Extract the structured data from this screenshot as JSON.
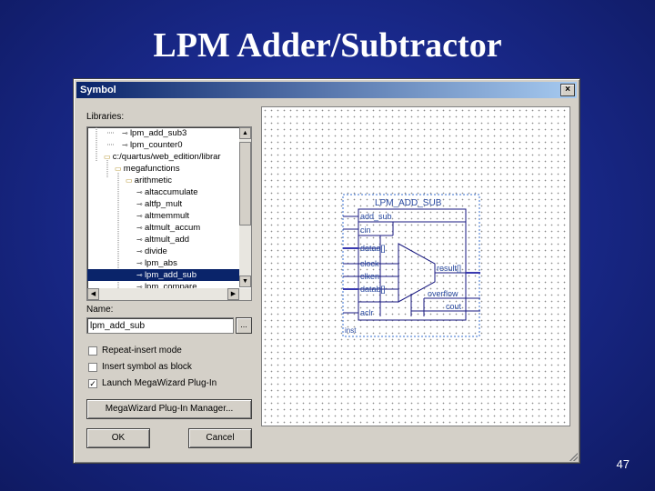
{
  "slide": {
    "title": "LPM Adder/Subtractor",
    "page_number": "47"
  },
  "dialog": {
    "title": "Symbol",
    "close_label": "×",
    "libraries_label": "Libraries:",
    "tree_items": [
      "lpm_add_sub3",
      "lpm_counter0",
      "c:/quartus/web_edition/librar",
      "megafunctions",
      "arithmetic",
      "altaccumulate",
      "altfp_mult",
      "altmemmult",
      "altmult_accum",
      "altmult_add",
      "divide",
      "lpm_abs",
      "lpm_add_sub",
      "lpm_compare"
    ],
    "selected_item": "lpm_add_sub",
    "name_label": "Name:",
    "name_value": "lpm_add_sub",
    "browse_label": "...",
    "checkboxes": [
      {
        "label": "Repeat-insert mode",
        "checked": false
      },
      {
        "label": "Insert symbol as block",
        "checked": false
      },
      {
        "label": "Launch MegaWizard Plug-In",
        "checked": true
      }
    ],
    "megawizard_button": "MegaWizard Plug-In Manager...",
    "ok_button": "OK",
    "cancel_button": "Cancel"
  },
  "symbol": {
    "title": "LPM_ADD_SUB",
    "inputs": [
      "add_sub",
      "cin",
      "dataa[]",
      "clock",
      "clken",
      "datab[]",
      "aclr"
    ],
    "outputs": [
      "result[]",
      "overflow",
      "cout"
    ],
    "instance": "inst"
  }
}
